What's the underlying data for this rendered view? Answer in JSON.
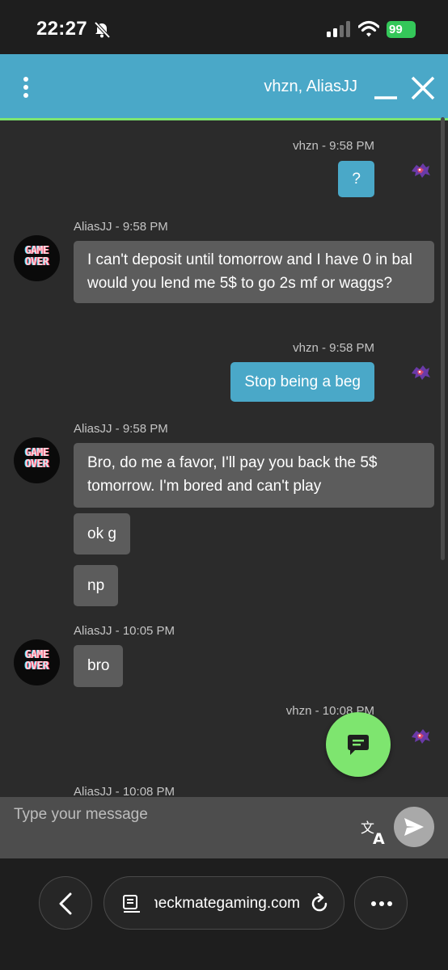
{
  "status_bar": {
    "time": "22:27",
    "battery": "99"
  },
  "chat": {
    "title": "vhzn, AliasJJ",
    "messages": [
      {
        "meta": "vhzn - 9:58 PM",
        "text": "?"
      },
      {
        "meta": "AliasJJ - 9:58 PM",
        "text": "I can't deposit until tomorrow and I have 0 in bal would you lend me 5$ to go 2s mf or waggs?"
      },
      {
        "meta": "vhzn - 9:58 PM",
        "text": "Stop being a beg"
      },
      {
        "meta": "AliasJJ - 9:58 PM",
        "text": "Bro, do me a favor, I'll pay you back the 5$ tomorrow. I'm bored and can't play"
      },
      {
        "text": "ok g"
      },
      {
        "text": "np"
      },
      {
        "meta": "AliasJJ - 10:05 PM",
        "text": "bro"
      },
      {
        "meta": "vhzn - 10:08 PM"
      },
      {
        "meta": "AliasJJ - 10:08 PM"
      }
    ],
    "avatar_text": "GAME OVER"
  },
  "input": {
    "placeholder": "Type your message"
  },
  "browser": {
    "url": "checkmategaming.com"
  },
  "colors": {
    "outgoing_bubble": "#4aa8c8",
    "incoming_bubble": "#5c5c5c",
    "accent_green": "#7ee56f",
    "header": "#4aa8c8"
  }
}
